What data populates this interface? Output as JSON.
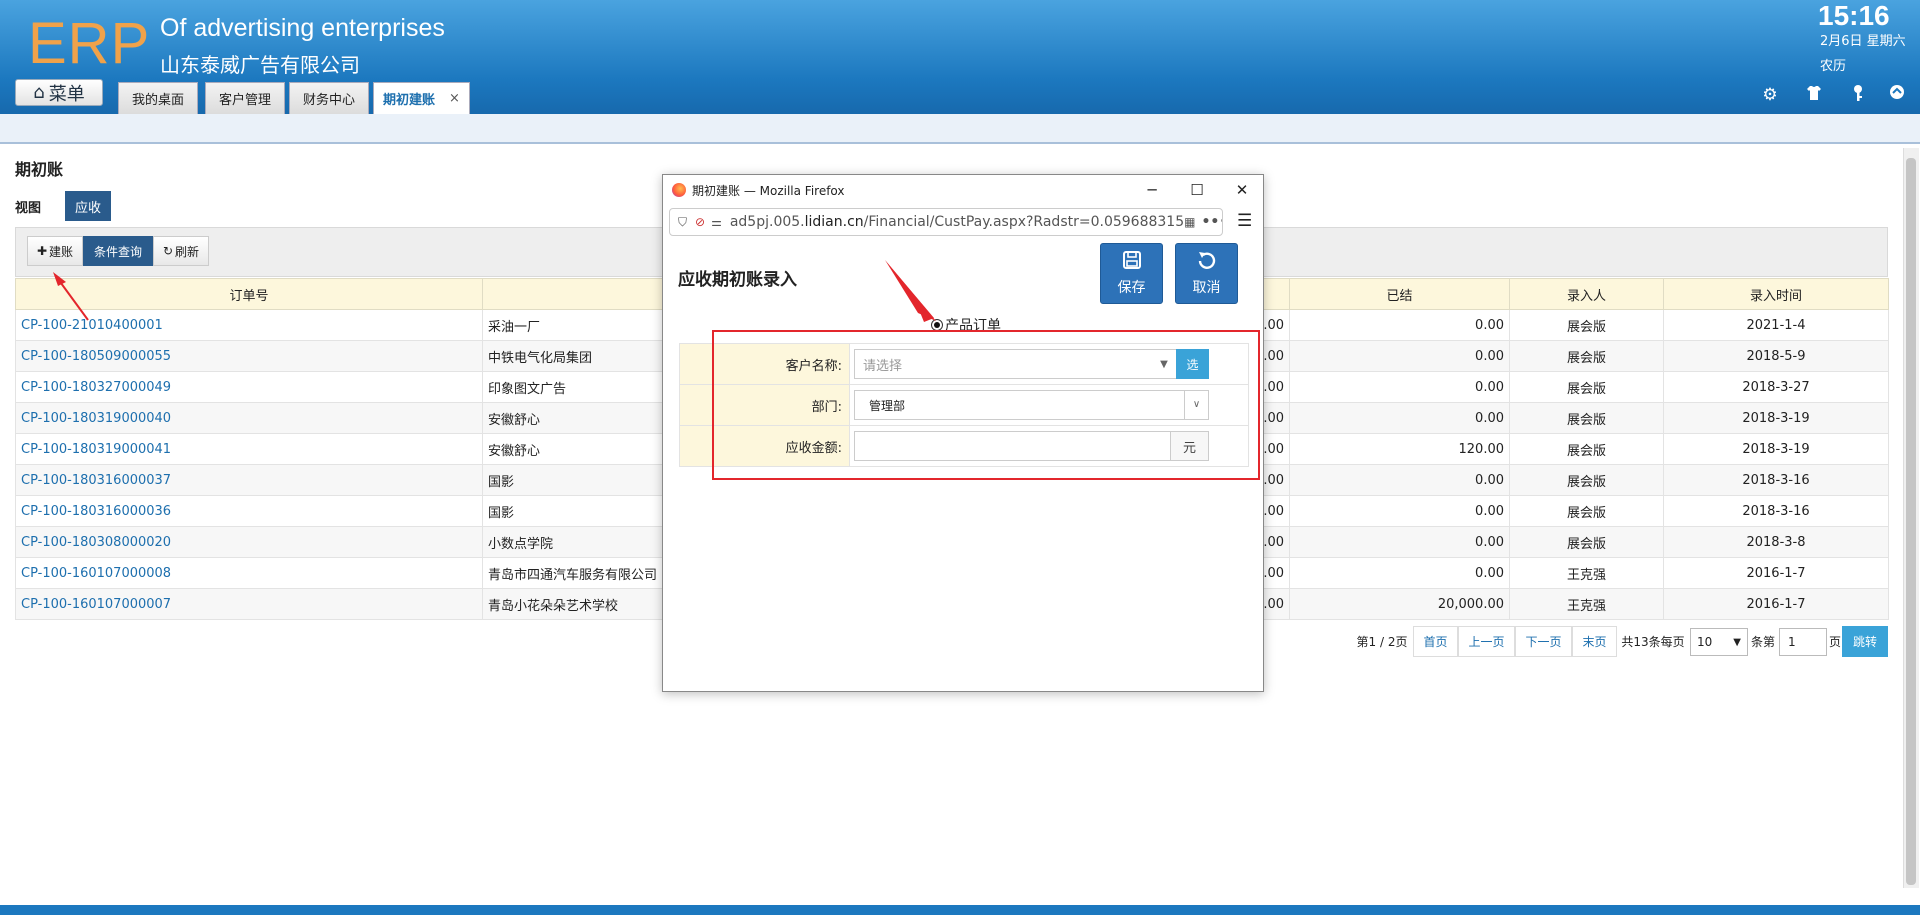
{
  "header": {
    "logo": "ERP",
    "title_en": "Of advertising enterprises",
    "title_cn": "山东泰威广告有限公司",
    "time": "15:16",
    "date": "2月6日 星期六",
    "lunar": "农历",
    "menu_label": "菜单",
    "tabs": [
      {
        "label": "我的桌面"
      },
      {
        "label": "客户管理"
      },
      {
        "label": "财务中心"
      },
      {
        "label": "期初建账",
        "close": "×"
      }
    ]
  },
  "page": {
    "title": "期初账",
    "view_label": "视图",
    "view_button": "应收",
    "toolbar": {
      "create": "建账",
      "query": "条件查询",
      "refresh": "刷新"
    }
  },
  "grid": {
    "columns": [
      "订单号",
      "",
      "",
      "已结",
      "录入人",
      "录入时间"
    ],
    "rows": [
      {
        "order": "CP-100-21010400001",
        "customer": "采油一厂",
        "amt": ".00",
        "settled": "0.00",
        "person": "展会版",
        "time": "2021-1-4"
      },
      {
        "order": "CP-100-180509000055",
        "customer": "中铁电气化局集团",
        "amt": ".00",
        "settled": "0.00",
        "person": "展会版",
        "time": "2018-5-9"
      },
      {
        "order": "CP-100-180327000049",
        "customer": "印象图文广告",
        "amt": ".00",
        "settled": "0.00",
        "person": "展会版",
        "time": "2018-3-27"
      },
      {
        "order": "CP-100-180319000040",
        "customer": "安徽舒心",
        "amt": ".00",
        "settled": "0.00",
        "person": "展会版",
        "time": "2018-3-19"
      },
      {
        "order": "CP-100-180319000041",
        "customer": "安徽舒心",
        "amt": ".00",
        "settled": "120.00",
        "person": "展会版",
        "time": "2018-3-19"
      },
      {
        "order": "CP-100-180316000037",
        "customer": "国影",
        "amt": ".00",
        "settled": "0.00",
        "person": "展会版",
        "time": "2018-3-16"
      },
      {
        "order": "CP-100-180316000036",
        "customer": "国影",
        "amt": ".00",
        "settled": "0.00",
        "person": "展会版",
        "time": "2018-3-16"
      },
      {
        "order": "CP-100-180308000020",
        "customer": "小数点学院",
        "amt": ".00",
        "settled": "0.00",
        "person": "展会版",
        "time": "2018-3-8"
      },
      {
        "order": "CP-100-160107000008",
        "customer": "青岛市四通汽车服务有限公司",
        "amt": ".00",
        "settled": "0.00",
        "person": "王克强",
        "time": "2016-1-7"
      },
      {
        "order": "CP-100-160107000007",
        "customer": "青岛小花朵朵艺术学校",
        "amt": ".00",
        "settled": "20,000.00",
        "person": "王克强",
        "time": "2016-1-7"
      }
    ]
  },
  "pager": {
    "info": "第1 / 2页",
    "first": "首页",
    "prev": "上一页",
    "next": "下一页",
    "last": "末页",
    "total": "共13条每页",
    "per_page": "10",
    "per_suffix": "条第",
    "page_no": "1",
    "page_suffix": "页",
    "go": "跳转"
  },
  "dialog": {
    "window_title": "期初建账 — Mozilla Firefox",
    "url_host_prefix": "ad5pj.005.",
    "url_host": "lidian.cn",
    "url_path": "/Financial/CustPay.aspx?Radstr=0.059688315",
    "heading": "应收期初账录入",
    "save": "保存",
    "cancel": "取消",
    "radio_label": "产品订单",
    "fields": {
      "customer_label": "客户名称:",
      "customer_placeholder": "请选择",
      "customer_pick": "选",
      "dept_label": "部门:",
      "dept_value": "管理部",
      "amount_label": "应收金额:",
      "amount_value": "",
      "amount_unit": "元"
    }
  }
}
